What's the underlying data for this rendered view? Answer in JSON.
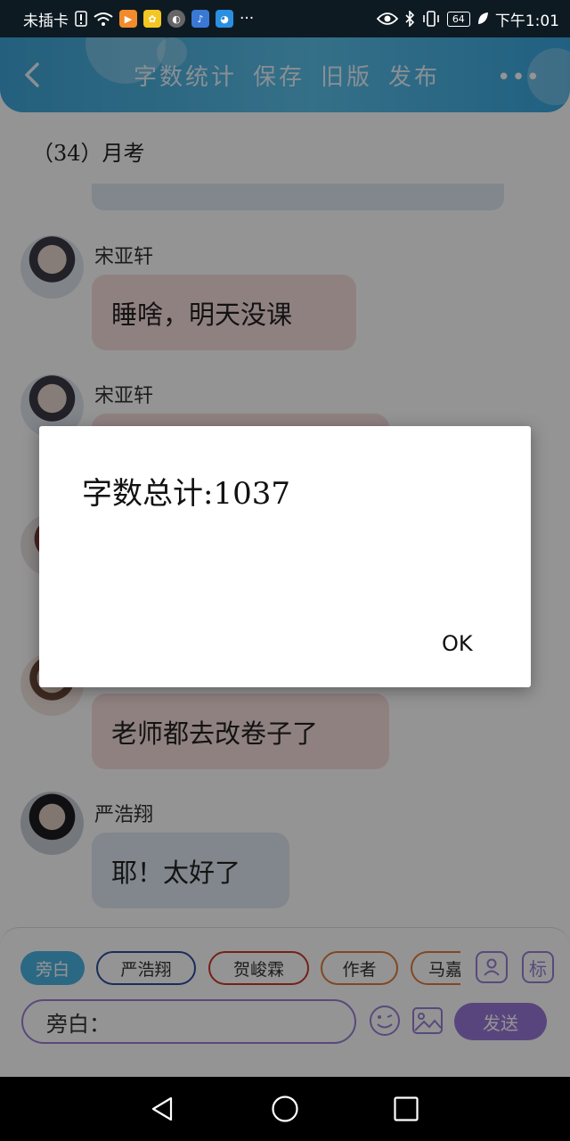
{
  "status_bar": {
    "carrier": "未插卡",
    "time": "下午1:01",
    "battery": "64",
    "more": "···"
  },
  "header": {
    "actions": [
      "字数统计",
      "保存",
      "旧版",
      "发布"
    ],
    "more": "•••"
  },
  "chat": {
    "title": "（34）月考",
    "messages": [
      {
        "sender": "宋亚轩",
        "text": "睡啥，明天没课"
      },
      {
        "sender": "宋亚轩",
        "text": ""
      },
      {
        "sender": "",
        "text": "老师都去改卷子了"
      },
      {
        "sender": "严浩翔",
        "text": "耶！太好了"
      }
    ]
  },
  "composer": {
    "chips": [
      "旁白",
      "严浩翔",
      "贺峻霖",
      "作者",
      "马嘉"
    ],
    "mark_button": "标",
    "input_value": "旁白：",
    "send_label": "发送"
  },
  "dialog": {
    "message": "字数总计:1037",
    "ok_label": "OK"
  },
  "colors": {
    "header_blue": "#4bb3e3",
    "accent_purple": "#9a78d8",
    "pink_bubble": "#f9dede",
    "blue_bubble": "#dfe8f1",
    "dialog_bg": "#ffffff"
  }
}
